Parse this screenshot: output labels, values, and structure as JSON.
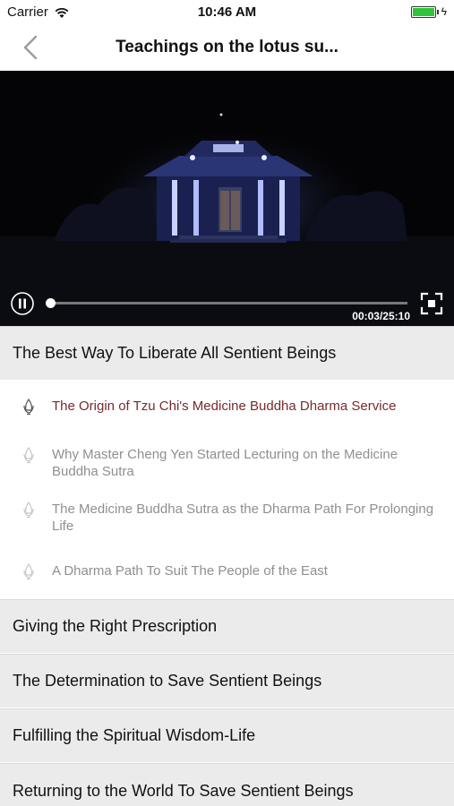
{
  "status_bar": {
    "carrier": "Carrier",
    "time": "10:46 AM",
    "battery_level": 1.0,
    "battery_color": "#2fc43a"
  },
  "nav": {
    "back_icon": "chevron-left-icon",
    "title": "Teachings on the lotus su..."
  },
  "player": {
    "state": "playing",
    "control_icon": "pause-icon",
    "current_time": "00:03",
    "total_time": "25:10",
    "time_display": "00:03/25:10",
    "progress": 0.002,
    "fullscreen_icon": "fullscreen-icon"
  },
  "chapters": [
    {
      "title": "The Best Way To Liberate All Sentient Beings",
      "expanded": true,
      "items": [
        {
          "label": "The Origin of Tzu Chi's Medicine Buddha Dharma Service",
          "active": true
        },
        {
          "label": "Why Master Cheng Yen Started Lecturing on the Medicine Buddha Sutra",
          "active": false
        },
        {
          "label": "The Medicine Buddha Sutra as the Dharma Path For Prolonging Life",
          "active": false
        },
        {
          "label": "A Dharma Path To Suit The People of the East",
          "active": false
        }
      ]
    },
    {
      "title": "Giving the Right Prescription",
      "expanded": false
    },
    {
      "title": "The Determination to Save Sentient Beings",
      "expanded": false
    },
    {
      "title": "Fulfilling the Spiritual Wisdom-Life",
      "expanded": false
    },
    {
      "title": "Returning to the World To Save Sentient Beings",
      "expanded": false
    }
  ],
  "colors": {
    "active_item": "#7a2a2a",
    "inactive_item": "#8f8f8f",
    "chapter_bg": "#ebebeb"
  }
}
